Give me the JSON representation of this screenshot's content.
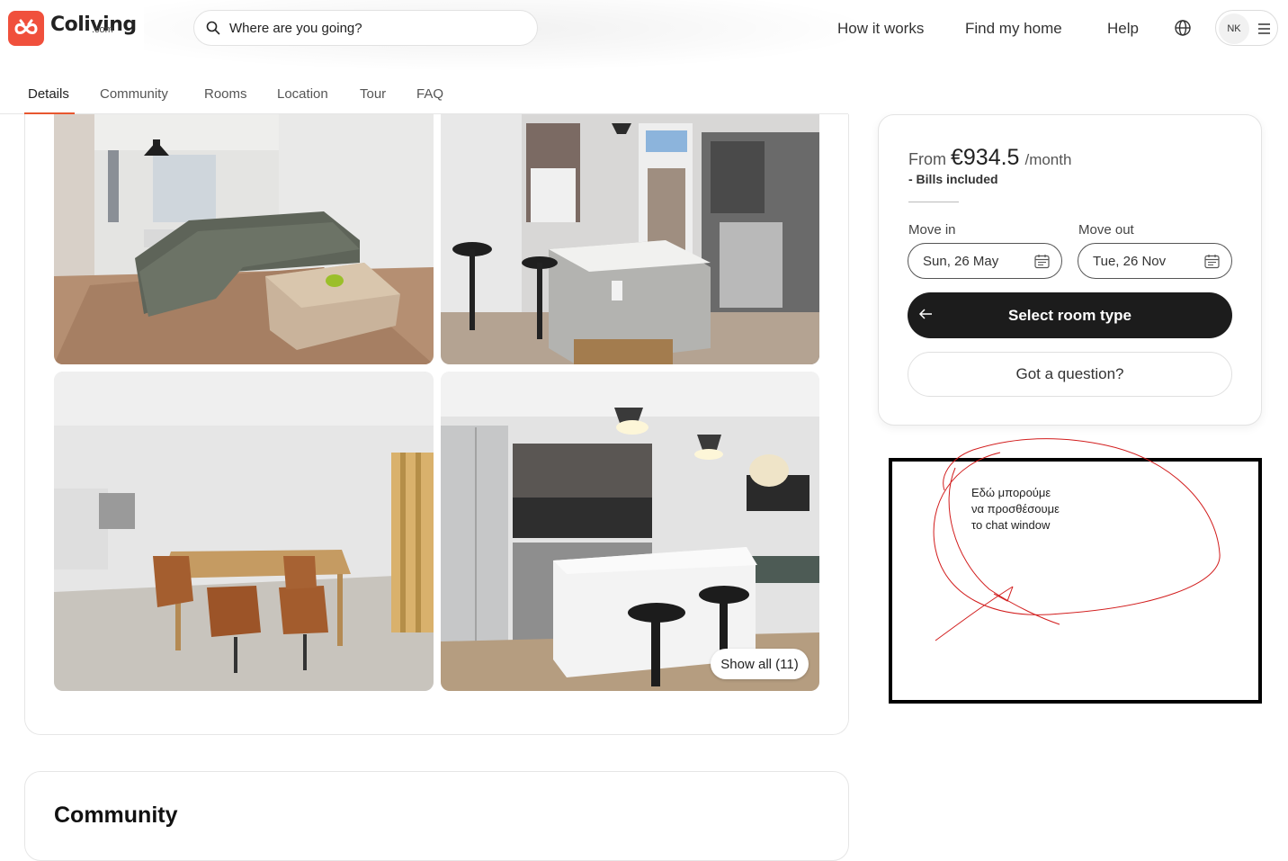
{
  "header": {
    "brand": "Coliving",
    "brand_suffix": ".com",
    "search_placeholder": "Where are you going?",
    "nav": [
      "How it works",
      "Find my home",
      "Help"
    ],
    "user_initials": "NK"
  },
  "tabs": [
    "Details",
    "Community",
    "Rooms",
    "Location",
    "Tour",
    "FAQ"
  ],
  "active_tab": "Details",
  "gallery": {
    "show_all_label": "Show all (11)"
  },
  "community": {
    "title": "Community"
  },
  "booking": {
    "price_prefix": "From",
    "price": "€934.5",
    "price_unit": "/month",
    "bills": "- Bills included",
    "move_in_label": "Move in",
    "move_in_value": "Sun, 26 May",
    "move_out_label": "Move out",
    "move_out_value": "Tue, 26 Nov",
    "select_label": "Select room type",
    "question_label": "Got a question?"
  },
  "annotation": {
    "line1": "Εδώ μπορούμε",
    "line2": "να προσθέσουμε",
    "line3": "το chat window"
  },
  "colors": {
    "brand": "#f0503c",
    "accent_underline": "#e8572f",
    "button_dark": "#1c1c1c",
    "scribble": "#d21d1d"
  }
}
